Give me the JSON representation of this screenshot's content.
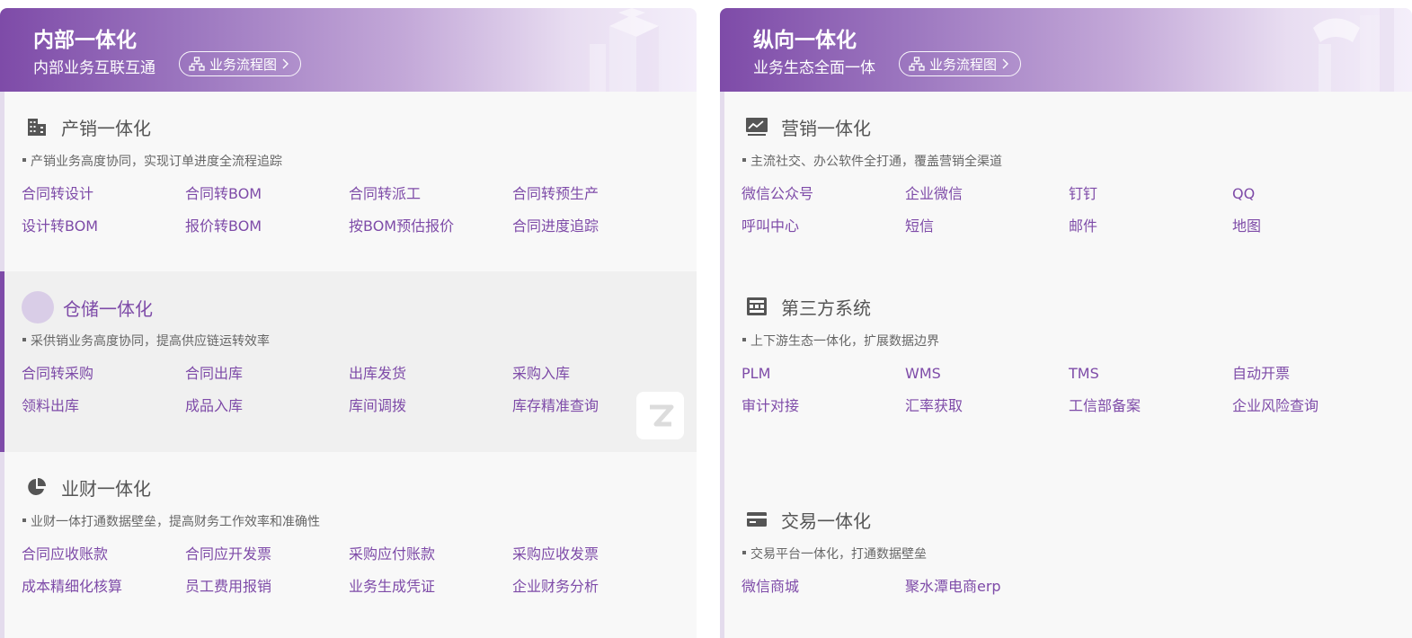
{
  "left": {
    "title": "内部一体化",
    "subtitle": "内部业务互联互通",
    "flow_button": "业务流程图",
    "sections": [
      {
        "title": "产销一体化",
        "icon": "building-icon",
        "desc": "产销业务高度协同，实现订单进度全流程追踪",
        "links": [
          "合同转设计",
          "合同转BOM",
          "合同转派工",
          "合同转预生产",
          "设计转BOM",
          "报价转BOM",
          "按BOM预估报价",
          "合同进度追踪"
        ]
      },
      {
        "title": "仓储一体化",
        "icon": "circle-icon",
        "desc": "采供销业务高度协同，提高供应链运转效率",
        "links": [
          "合同转采购",
          "合同出库",
          "出库发货",
          "采购入库",
          "领料出库",
          "成品入库",
          "库间调拨",
          "库存精准查询"
        ]
      },
      {
        "title": "业财一体化",
        "icon": "pie-chart-icon",
        "desc": "业财一体打通数据壁垒，提高财务工作效率和准确性",
        "links": [
          "合同应收账款",
          "合同应开发票",
          "采购应付账款",
          "采购应收发票",
          "成本精细化核算",
          "员工费用报销",
          "业务生成凭证",
          "企业财务分析"
        ]
      }
    ]
  },
  "right": {
    "title": "纵向一体化",
    "subtitle": "业务生态全面一体",
    "flow_button": "业务流程图",
    "sections": [
      {
        "title": "营销一体化",
        "icon": "trend-chart-icon",
        "desc": "主流社交、办公软件全打通，覆盖营销全渠道",
        "links": [
          "微信公众号",
          "企业微信",
          "钉钉",
          "QQ",
          "呼叫中心",
          "短信",
          "邮件",
          "地图"
        ]
      },
      {
        "title": "第三方系统",
        "icon": "system-icon",
        "desc": "上下游生态一体化，扩展数据边界",
        "links": [
          "PLM",
          "WMS",
          "TMS",
          "自动开票",
          "审计对接",
          "汇率获取",
          "工信部备案",
          "企业风险查询"
        ]
      },
      {
        "title": "交易一体化",
        "icon": "card-icon",
        "desc": "交易平台一体化，打通数据壁垒",
        "links": [
          "微信商城",
          "聚水潭电商erp"
        ]
      }
    ]
  },
  "colors": {
    "accent": "#7e4ba8",
    "panel_bg": "#f8f8f8"
  }
}
